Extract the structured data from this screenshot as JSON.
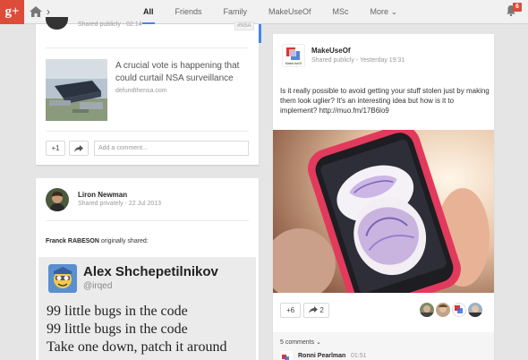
{
  "app": {
    "logo_text": "g+",
    "logo_color": "#dd4b39",
    "accent": "#4285f4"
  },
  "header": {
    "breadcrumb_chevron": "›",
    "tabs": [
      {
        "label": "All",
        "active": true
      },
      {
        "label": "Friends",
        "active": false
      },
      {
        "label": "Family",
        "active": false
      },
      {
        "label": "MakeUseOf",
        "active": false
      },
      {
        "label": "MSc",
        "active": false
      },
      {
        "label": "More",
        "active": false
      }
    ],
    "more_chevron": "⌄",
    "notification_count": "6"
  },
  "post1": {
    "visibility": "Shared publicly",
    "time": "02:14",
    "tag": "#NSA",
    "headline": "A crucial vote is happening that could curtail NSA surveillance",
    "domain": "defundthensa.com",
    "plus_label": "+1",
    "share_icon": "share-icon",
    "comment_placeholder": "Add a comment..."
  },
  "post2": {
    "author": "Liron Newman",
    "visibility": "Shared privately",
    "time": "22 Jul 2013",
    "shared_by": "Franck RABESON",
    "shared_suffix": " originally shared:",
    "tweet": {
      "name": "Alex Shchepetilnikov",
      "handle": "@irqed",
      "lines": [
        "99 little bugs in the code",
        "99 little bugs in the code",
        "Take one down, patch it around"
      ]
    }
  },
  "post3": {
    "author": "MakeUseOf",
    "visibility": "Shared publicly",
    "time": "Yesterday 19:31",
    "logo_text": "MakeUseOf",
    "text": "Is it really possible to avoid getting your stuff stolen just by making them look uglier? It's an interesting idea but how is it to implement? http://muo.fm/17B6lo9",
    "plus_label": "+6",
    "share_count": "2",
    "comments_label": "5 comments",
    "comments_chevron": "⌄",
    "first_commenter": "Ronni Pearlman",
    "first_comment_time": "01:51"
  }
}
